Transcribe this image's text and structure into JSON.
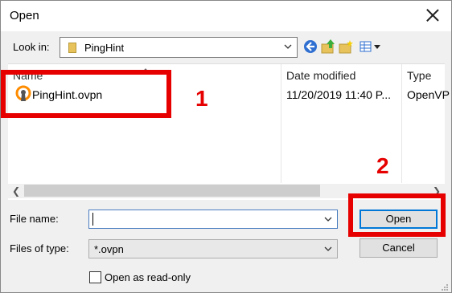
{
  "dialog": {
    "title": "Open"
  },
  "lookin": {
    "label": "Look in:",
    "value": "PingHint"
  },
  "toolbar": {
    "icons": [
      "back-icon",
      "up-folder-icon",
      "new-folder-icon",
      "view-menu-icon"
    ]
  },
  "columns": {
    "name": "Name",
    "date": "Date modified",
    "type": "Type"
  },
  "files": [
    {
      "name": "PingHint.ovpn",
      "date": "11/20/2019 11:40 P...",
      "type": "OpenVP"
    }
  ],
  "annotations": {
    "step1": "1",
    "step2": "2",
    "color": "#e60000"
  },
  "filename": {
    "label": "File name:",
    "value": ""
  },
  "filetypes": {
    "label": "Files of type:",
    "value": "*.ovpn"
  },
  "buttons": {
    "open": "Open",
    "cancel": "Cancel"
  },
  "readonly": {
    "label": "Open as read-only",
    "checked": false
  },
  "colors": {
    "accent": "#0078d7",
    "file_icon": "#ff8c00"
  }
}
